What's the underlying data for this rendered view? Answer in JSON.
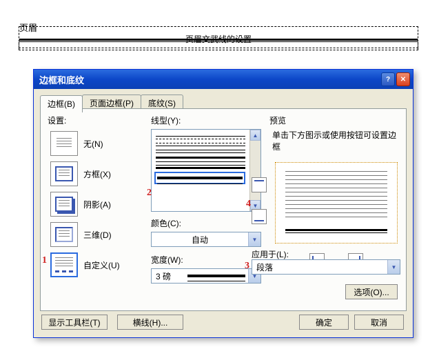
{
  "header": {
    "label": "页眉",
    "text": "页眉文武线的设置"
  },
  "dialog": {
    "title": "边框和底纹",
    "tabs": {
      "borders": "边框(B)",
      "page_border": "页面边框(P)",
      "shading": "底纹(S)"
    },
    "setting": {
      "label": "设置:",
      "none": "无(N)",
      "box": "方框(X)",
      "shadow": "阴影(A)",
      "three_d": "三维(D)",
      "custom": "自定义(U)"
    },
    "style": {
      "label": "线型(Y):"
    },
    "color": {
      "label": "颜色(C):",
      "value": "自动"
    },
    "width": {
      "label": "宽度(W):",
      "value": "3 磅"
    },
    "preview": {
      "label": "预览",
      "hint": "单击下方图示或使用按钮可设置边框"
    },
    "apply": {
      "label": "应用于(L):",
      "value": "段落"
    },
    "options": "选项(O)...",
    "show_toolbar": "显示工具栏(T)",
    "hline": "横线(H)...",
    "ok": "确定",
    "cancel": "取消"
  },
  "annotations": {
    "a1": "1",
    "a2": "2",
    "a3": "3",
    "a4": "4"
  }
}
